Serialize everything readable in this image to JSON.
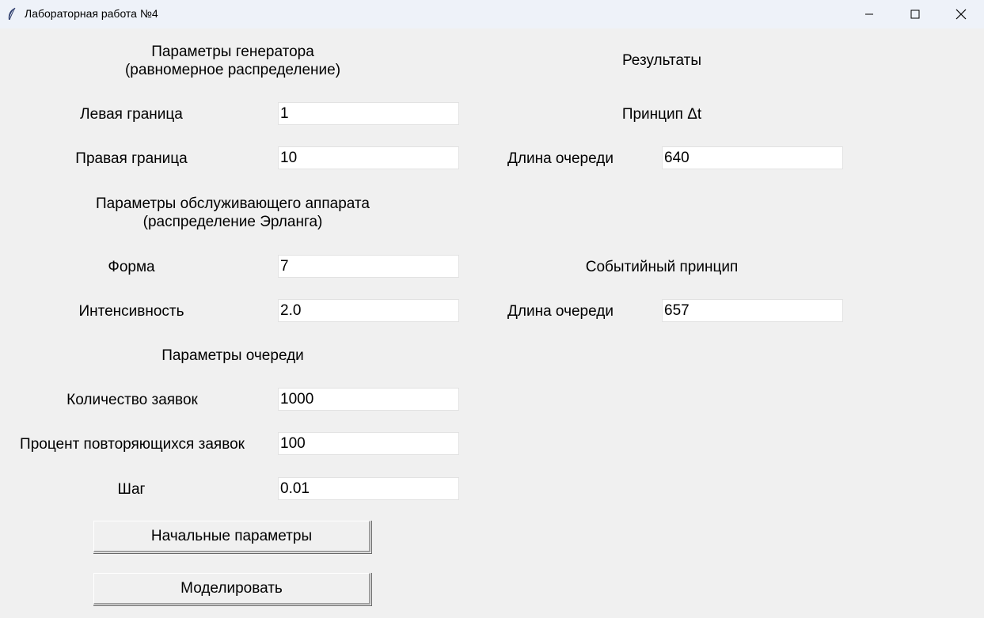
{
  "window": {
    "title": "Лабораторная работа №4"
  },
  "generator": {
    "heading_line1": "Параметры генератора",
    "heading_line2": "(равномерное распределение)",
    "left_bound_label": "Левая граница",
    "left_bound_value": "1",
    "right_bound_label": "Правая граница",
    "right_bound_value": "10"
  },
  "server": {
    "heading_line1": "Параметры обслуживающего аппарата",
    "heading_line2": "(распределение Эрланга)",
    "shape_label": "Форма",
    "shape_value": "7",
    "intensity_label": "Интенсивность",
    "intensity_value": "2.0"
  },
  "queue": {
    "heading": "Параметры очереди",
    "requests_label": "Количество заявок",
    "requests_value": "1000",
    "repeat_label": "Процент повторяющихся заявок",
    "repeat_value": "100",
    "step_label": "Шаг",
    "step_value": "0.01"
  },
  "buttons": {
    "defaults_label": "Начальные параметры",
    "simulate_label": "Моделировать"
  },
  "results": {
    "heading": "Результаты",
    "dt_heading": "Принцип Δt",
    "dt_queue_label": "Длина очереди",
    "dt_queue_value": "640",
    "event_heading": "Событийный принцип",
    "event_queue_label": "Длина очереди",
    "event_queue_value": "657"
  }
}
